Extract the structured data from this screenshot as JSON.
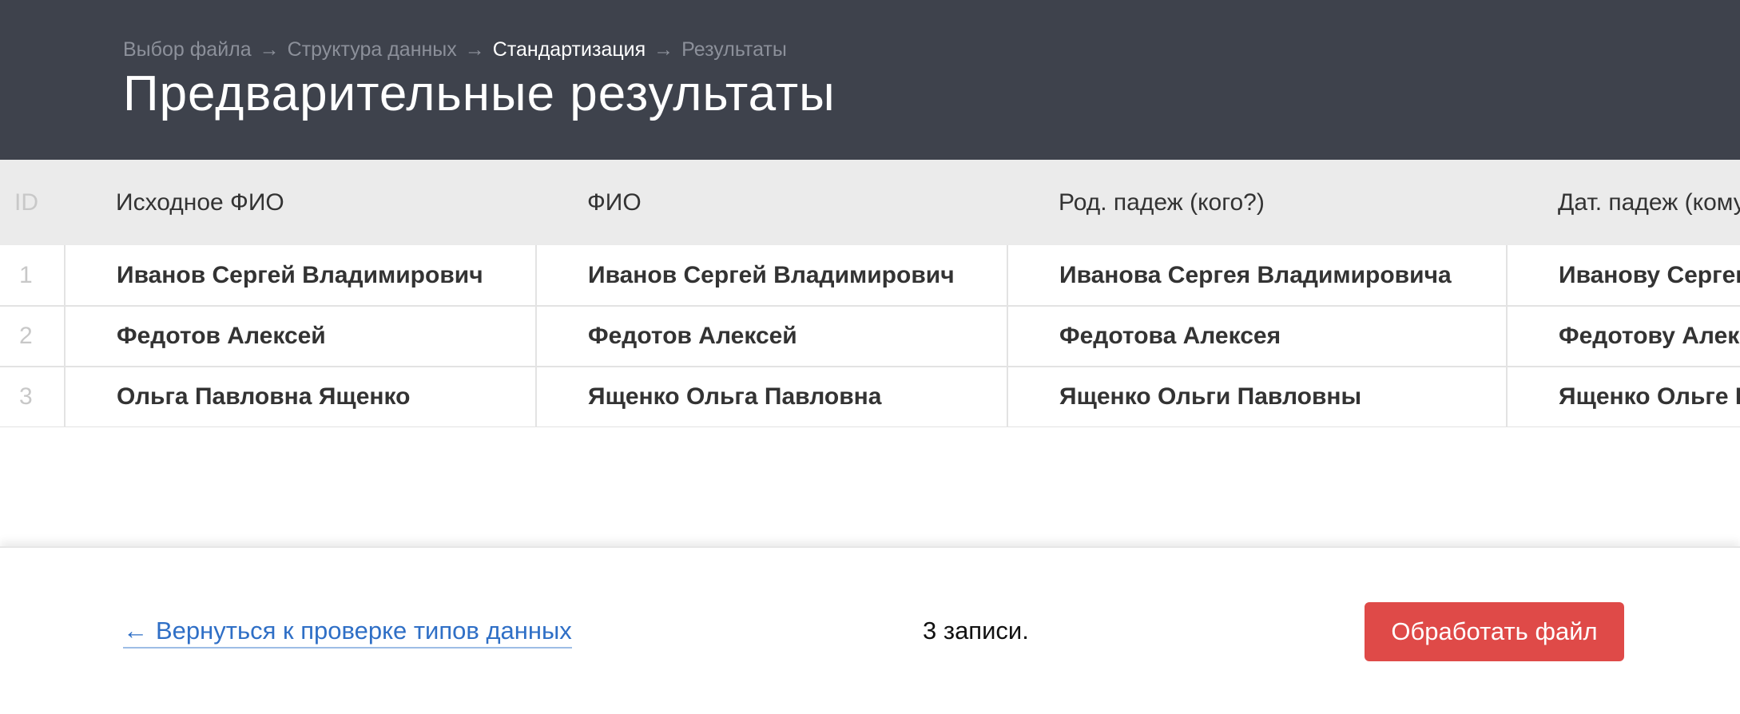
{
  "breadcrumb": {
    "items": [
      {
        "label": "Выбор файла",
        "active": false
      },
      {
        "label": "Структура данных",
        "active": false
      },
      {
        "label": "Стандартизация",
        "active": true
      },
      {
        "label": "Результаты",
        "active": false
      }
    ],
    "separator": "→"
  },
  "page_title": "Предварительные результаты",
  "table": {
    "columns": [
      "ID",
      "Исходное ФИО",
      "ФИО",
      "Род. падеж (кого?)",
      "Дат. падеж (кому?)"
    ],
    "rows": [
      [
        "1",
        "Иванов Сергей Владимирович",
        "Иванов Сергей Владимирович",
        "Иванова Сергея Владимировича",
        "Иванову Сергею Владимировичу"
      ],
      [
        "2",
        "Федотов Алексей",
        "Федотов Алексей",
        "Федотова Алексея",
        "Федотову Алексею"
      ],
      [
        "3",
        "Ольга Павловна Ященко",
        "Ященко Ольга Павловна",
        "Ященко Ольги Павловны",
        "Ященко Ольге Павловне"
      ]
    ]
  },
  "footer": {
    "back_arrow": "←",
    "back_label": "Вернуться к проверке типов данных",
    "records_text": "3 записи.",
    "process_label": "Обработать файл"
  },
  "colors": {
    "header_bg": "#3e424c",
    "accent_button": "#df4a48",
    "link": "#2f6fc6"
  }
}
